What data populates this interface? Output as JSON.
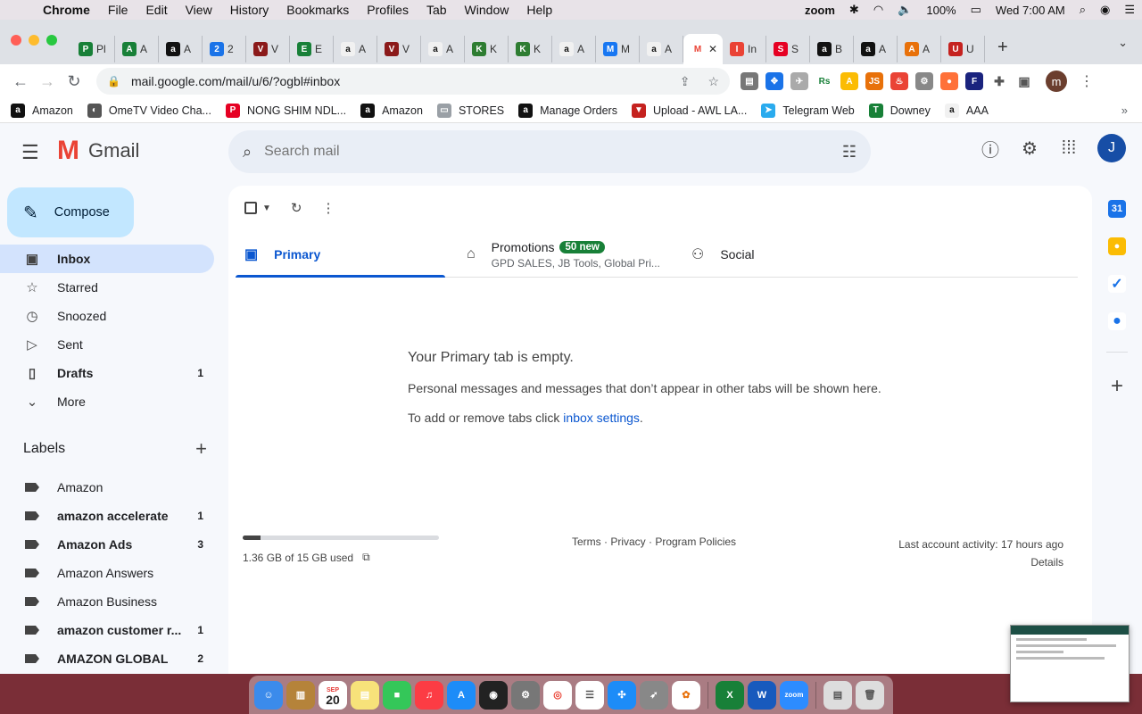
{
  "menubar": {
    "app": "Chrome",
    "items": [
      "File",
      "Edit",
      "View",
      "History",
      "Bookmarks",
      "Profiles",
      "Tab",
      "Window",
      "Help"
    ],
    "zoom": "zoom",
    "battery": "100%",
    "datetime": "Wed 7:00 AM"
  },
  "browser": {
    "url": "mail.google.com/mail/u/6/?ogbl#inbox",
    "tabs": [
      {
        "letter": "Pl",
        "color": "#188038",
        "icon": "sheets-icon"
      },
      {
        "letter": "A",
        "color": "#188038",
        "icon": "sheets-icon"
      },
      {
        "letter": "A",
        "color": "#111111",
        "icon": "amazon-icon"
      },
      {
        "letter": "2",
        "color": "#1a73e8",
        "icon": "circle-2-icon"
      },
      {
        "letter": "V",
        "color": "#8b1a1a",
        "icon": "vw-icon"
      },
      {
        "letter": "E",
        "color": "#188038",
        "icon": "sheets-icon"
      },
      {
        "letter": "A",
        "color": "#f1f1f1",
        "icon": "amazon-icon"
      },
      {
        "letter": "V",
        "color": "#8b1a1a",
        "icon": "vw-icon"
      },
      {
        "letter": "A",
        "color": "#f1f1f1",
        "icon": "amazon-icon"
      },
      {
        "letter": "K",
        "color": "#2e7d32",
        "icon": "k-icon"
      },
      {
        "letter": "K",
        "color": "#2e7d32",
        "icon": "k-icon"
      },
      {
        "letter": "A",
        "color": "#f1f1f1",
        "icon": "amazon-icon"
      },
      {
        "letter": "M",
        "color": "#1877f2",
        "icon": "facebook-icon"
      },
      {
        "letter": "A",
        "color": "#f1f1f1",
        "icon": "amazon-icon"
      },
      {
        "letter": "In",
        "color": "#ea4335",
        "icon": "gmail-icon"
      },
      {
        "letter": "S",
        "color": "#e60023",
        "icon": "pinterest-icon"
      },
      {
        "letter": "B",
        "color": "#111111",
        "icon": "amazon-icon"
      },
      {
        "letter": "A",
        "color": "#111111",
        "icon": "amazon-icon"
      },
      {
        "letter": "A",
        "color": "#e8710a",
        "icon": "tag-icon"
      },
      {
        "letter": "U",
        "color": "#c5221f",
        "icon": "triangle-icon"
      }
    ],
    "bookmarks": [
      {
        "label": "Amazon",
        "color": "#111111",
        "glyph": "a"
      },
      {
        "label": "OmeTV Video Cha...",
        "color": "#555555",
        "glyph": "◐"
      },
      {
        "label": "NONG SHIM NDL...",
        "color": "#e60023",
        "glyph": "P"
      },
      {
        "label": "Amazon",
        "color": "#111111",
        "glyph": "a"
      },
      {
        "label": "STORES",
        "color": "#9aa0a6",
        "glyph": "▭"
      },
      {
        "label": "Manage Orders",
        "color": "#111111",
        "glyph": "a"
      },
      {
        "label": "Upload - AWL LA...",
        "color": "#c5221f",
        "glyph": "▼"
      },
      {
        "label": "Telegram Web",
        "color": "#2aabee",
        "glyph": "➤"
      },
      {
        "label": "Downey",
        "color": "#188038",
        "glyph": "T"
      },
      {
        "label": "AAA",
        "color": "#f1f1f1",
        "glyph": "a"
      }
    ]
  },
  "gmail": {
    "logo_text": "Gmail",
    "search_placeholder": "Search mail",
    "avatar_letter": "J",
    "compose_label": "Compose",
    "nav": [
      {
        "label": "Inbox",
        "icon": "inbox-icon",
        "glyph": "▣",
        "count": "",
        "active": true,
        "bold": true
      },
      {
        "label": "Starred",
        "icon": "star-icon",
        "glyph": "☆",
        "count": "",
        "active": false,
        "bold": false
      },
      {
        "label": "Snoozed",
        "icon": "clock-icon",
        "glyph": "◷",
        "count": "",
        "active": false,
        "bold": false
      },
      {
        "label": "Sent",
        "icon": "send-icon",
        "glyph": "▷",
        "count": "",
        "active": false,
        "bold": false
      },
      {
        "label": "Drafts",
        "icon": "draft-icon",
        "glyph": "▯",
        "count": "1",
        "active": false,
        "bold": true
      },
      {
        "label": "More",
        "icon": "chevron-down-icon",
        "glyph": "⌄",
        "count": "",
        "active": false,
        "bold": false
      }
    ],
    "labels_title": "Labels",
    "labels": [
      {
        "label": "Amazon",
        "count": "",
        "bold": false
      },
      {
        "label": "amazon accelerate",
        "count": "1",
        "bold": true
      },
      {
        "label": "Amazon Ads",
        "count": "3",
        "bold": true
      },
      {
        "label": "Amazon Answers",
        "count": "",
        "bold": false
      },
      {
        "label": "Amazon Business",
        "count": "",
        "bold": false
      },
      {
        "label": "amazon customer r...",
        "count": "1",
        "bold": true
      },
      {
        "label": "AMAZON GLOBAL",
        "count": "2",
        "bold": true
      }
    ],
    "tabs": {
      "primary": "Primary",
      "promotions": "Promotions",
      "promotions_badge": "50 new",
      "promotions_sub": "GPD SALES, JB Tools, Global Pri...",
      "social": "Social"
    },
    "empty": {
      "title": "Your Primary tab is empty.",
      "line1": "Personal messages and messages that don’t appear in other tabs will be shown here.",
      "line2_prefix": "To add or remove tabs click ",
      "line2_link": "inbox settings",
      "line2_suffix": "."
    },
    "footer": {
      "storage_fraction": 0.09,
      "storage_text": "1.36 GB of 15 GB used",
      "links": "Terms · Privacy · Program Policies",
      "activity": "Last account activity: 17 hours ago",
      "details": "Details"
    }
  },
  "dock": {
    "calendar_day": "20",
    "calendar_month": "SEP",
    "zoom_label": "zoom"
  }
}
